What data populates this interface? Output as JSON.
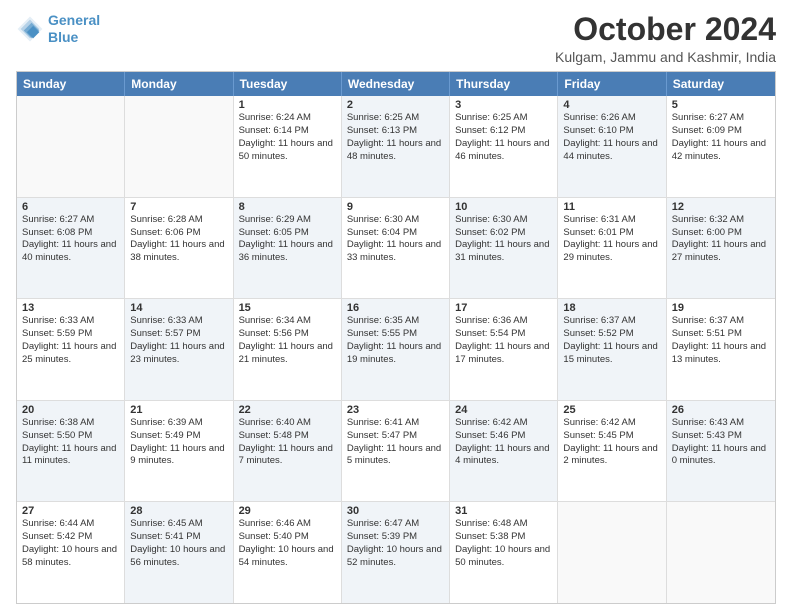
{
  "logo": {
    "line1": "General",
    "line2": "Blue"
  },
  "header": {
    "month_year": "October 2024",
    "location": "Kulgam, Jammu and Kashmir, India"
  },
  "days_of_week": [
    "Sunday",
    "Monday",
    "Tuesday",
    "Wednesday",
    "Thursday",
    "Friday",
    "Saturday"
  ],
  "rows": [
    [
      {
        "day": "",
        "sunrise": "",
        "sunset": "",
        "daylight": "",
        "alt": false,
        "empty": true
      },
      {
        "day": "",
        "sunrise": "",
        "sunset": "",
        "daylight": "",
        "alt": false,
        "empty": true
      },
      {
        "day": "1",
        "sunrise": "Sunrise: 6:24 AM",
        "sunset": "Sunset: 6:14 PM",
        "daylight": "Daylight: 11 hours and 50 minutes.",
        "alt": false,
        "empty": false
      },
      {
        "day": "2",
        "sunrise": "Sunrise: 6:25 AM",
        "sunset": "Sunset: 6:13 PM",
        "daylight": "Daylight: 11 hours and 48 minutes.",
        "alt": true,
        "empty": false
      },
      {
        "day": "3",
        "sunrise": "Sunrise: 6:25 AM",
        "sunset": "Sunset: 6:12 PM",
        "daylight": "Daylight: 11 hours and 46 minutes.",
        "alt": false,
        "empty": false
      },
      {
        "day": "4",
        "sunrise": "Sunrise: 6:26 AM",
        "sunset": "Sunset: 6:10 PM",
        "daylight": "Daylight: 11 hours and 44 minutes.",
        "alt": true,
        "empty": false
      },
      {
        "day": "5",
        "sunrise": "Sunrise: 6:27 AM",
        "sunset": "Sunset: 6:09 PM",
        "daylight": "Daylight: 11 hours and 42 minutes.",
        "alt": false,
        "empty": false
      }
    ],
    [
      {
        "day": "6",
        "sunrise": "Sunrise: 6:27 AM",
        "sunset": "Sunset: 6:08 PM",
        "daylight": "Daylight: 11 hours and 40 minutes.",
        "alt": true,
        "empty": false
      },
      {
        "day": "7",
        "sunrise": "Sunrise: 6:28 AM",
        "sunset": "Sunset: 6:06 PM",
        "daylight": "Daylight: 11 hours and 38 minutes.",
        "alt": false,
        "empty": false
      },
      {
        "day": "8",
        "sunrise": "Sunrise: 6:29 AM",
        "sunset": "Sunset: 6:05 PM",
        "daylight": "Daylight: 11 hours and 36 minutes.",
        "alt": true,
        "empty": false
      },
      {
        "day": "9",
        "sunrise": "Sunrise: 6:30 AM",
        "sunset": "Sunset: 6:04 PM",
        "daylight": "Daylight: 11 hours and 33 minutes.",
        "alt": false,
        "empty": false
      },
      {
        "day": "10",
        "sunrise": "Sunrise: 6:30 AM",
        "sunset": "Sunset: 6:02 PM",
        "daylight": "Daylight: 11 hours and 31 minutes.",
        "alt": true,
        "empty": false
      },
      {
        "day": "11",
        "sunrise": "Sunrise: 6:31 AM",
        "sunset": "Sunset: 6:01 PM",
        "daylight": "Daylight: 11 hours and 29 minutes.",
        "alt": false,
        "empty": false
      },
      {
        "day": "12",
        "sunrise": "Sunrise: 6:32 AM",
        "sunset": "Sunset: 6:00 PM",
        "daylight": "Daylight: 11 hours and 27 minutes.",
        "alt": true,
        "empty": false
      }
    ],
    [
      {
        "day": "13",
        "sunrise": "Sunrise: 6:33 AM",
        "sunset": "Sunset: 5:59 PM",
        "daylight": "Daylight: 11 hours and 25 minutes.",
        "alt": false,
        "empty": false
      },
      {
        "day": "14",
        "sunrise": "Sunrise: 6:33 AM",
        "sunset": "Sunset: 5:57 PM",
        "daylight": "Daylight: 11 hours and 23 minutes.",
        "alt": true,
        "empty": false
      },
      {
        "day": "15",
        "sunrise": "Sunrise: 6:34 AM",
        "sunset": "Sunset: 5:56 PM",
        "daylight": "Daylight: 11 hours and 21 minutes.",
        "alt": false,
        "empty": false
      },
      {
        "day": "16",
        "sunrise": "Sunrise: 6:35 AM",
        "sunset": "Sunset: 5:55 PM",
        "daylight": "Daylight: 11 hours and 19 minutes.",
        "alt": true,
        "empty": false
      },
      {
        "day": "17",
        "sunrise": "Sunrise: 6:36 AM",
        "sunset": "Sunset: 5:54 PM",
        "daylight": "Daylight: 11 hours and 17 minutes.",
        "alt": false,
        "empty": false
      },
      {
        "day": "18",
        "sunrise": "Sunrise: 6:37 AM",
        "sunset": "Sunset: 5:52 PM",
        "daylight": "Daylight: 11 hours and 15 minutes.",
        "alt": true,
        "empty": false
      },
      {
        "day": "19",
        "sunrise": "Sunrise: 6:37 AM",
        "sunset": "Sunset: 5:51 PM",
        "daylight": "Daylight: 11 hours and 13 minutes.",
        "alt": false,
        "empty": false
      }
    ],
    [
      {
        "day": "20",
        "sunrise": "Sunrise: 6:38 AM",
        "sunset": "Sunset: 5:50 PM",
        "daylight": "Daylight: 11 hours and 11 minutes.",
        "alt": true,
        "empty": false
      },
      {
        "day": "21",
        "sunrise": "Sunrise: 6:39 AM",
        "sunset": "Sunset: 5:49 PM",
        "daylight": "Daylight: 11 hours and 9 minutes.",
        "alt": false,
        "empty": false
      },
      {
        "day": "22",
        "sunrise": "Sunrise: 6:40 AM",
        "sunset": "Sunset: 5:48 PM",
        "daylight": "Daylight: 11 hours and 7 minutes.",
        "alt": true,
        "empty": false
      },
      {
        "day": "23",
        "sunrise": "Sunrise: 6:41 AM",
        "sunset": "Sunset: 5:47 PM",
        "daylight": "Daylight: 11 hours and 5 minutes.",
        "alt": false,
        "empty": false
      },
      {
        "day": "24",
        "sunrise": "Sunrise: 6:42 AM",
        "sunset": "Sunset: 5:46 PM",
        "daylight": "Daylight: 11 hours and 4 minutes.",
        "alt": true,
        "empty": false
      },
      {
        "day": "25",
        "sunrise": "Sunrise: 6:42 AM",
        "sunset": "Sunset: 5:45 PM",
        "daylight": "Daylight: 11 hours and 2 minutes.",
        "alt": false,
        "empty": false
      },
      {
        "day": "26",
        "sunrise": "Sunrise: 6:43 AM",
        "sunset": "Sunset: 5:43 PM",
        "daylight": "Daylight: 11 hours and 0 minutes.",
        "alt": true,
        "empty": false
      }
    ],
    [
      {
        "day": "27",
        "sunrise": "Sunrise: 6:44 AM",
        "sunset": "Sunset: 5:42 PM",
        "daylight": "Daylight: 10 hours and 58 minutes.",
        "alt": false,
        "empty": false
      },
      {
        "day": "28",
        "sunrise": "Sunrise: 6:45 AM",
        "sunset": "Sunset: 5:41 PM",
        "daylight": "Daylight: 10 hours and 56 minutes.",
        "alt": true,
        "empty": false
      },
      {
        "day": "29",
        "sunrise": "Sunrise: 6:46 AM",
        "sunset": "Sunset: 5:40 PM",
        "daylight": "Daylight: 10 hours and 54 minutes.",
        "alt": false,
        "empty": false
      },
      {
        "day": "30",
        "sunrise": "Sunrise: 6:47 AM",
        "sunset": "Sunset: 5:39 PM",
        "daylight": "Daylight: 10 hours and 52 minutes.",
        "alt": true,
        "empty": false
      },
      {
        "day": "31",
        "sunrise": "Sunrise: 6:48 AM",
        "sunset": "Sunset: 5:38 PM",
        "daylight": "Daylight: 10 hours and 50 minutes.",
        "alt": false,
        "empty": false
      },
      {
        "day": "",
        "sunrise": "",
        "sunset": "",
        "daylight": "",
        "alt": true,
        "empty": true
      },
      {
        "day": "",
        "sunrise": "",
        "sunset": "",
        "daylight": "",
        "alt": false,
        "empty": true
      }
    ]
  ]
}
